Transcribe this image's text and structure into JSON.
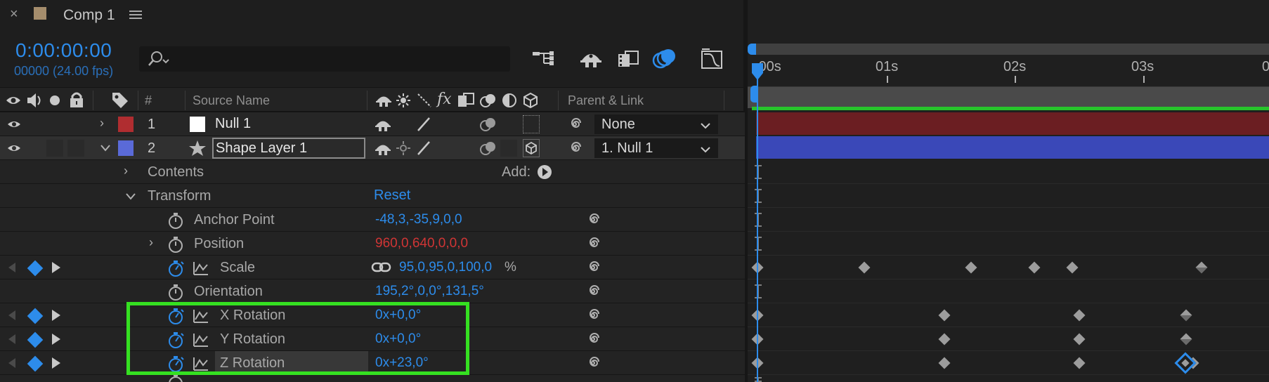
{
  "tab": {
    "close_glyph": "×",
    "title": "Comp 1"
  },
  "header": {
    "timecode": "0:00:00:00",
    "frame_info": "00000 (24.00 fps)",
    "search_placeholder": ""
  },
  "columns": {
    "number": "#",
    "source_name": "Source Name",
    "fx_glyph": "fx",
    "parent_link": "Parent & Link"
  },
  "glyphs": {
    "chevron_right": "›"
  },
  "layers": [
    {
      "number": "1",
      "name": "Null 1",
      "label_color": "#b02d30",
      "parent": "None"
    },
    {
      "number": "2",
      "name": "Shape Layer 1",
      "label_color": "#5a6ad8",
      "parent": "1. Null 1"
    }
  ],
  "props": {
    "contents": "Contents",
    "add_label": "Add:",
    "transform": "Transform",
    "reset": "Reset",
    "anchor_point": {
      "label": "Anchor Point",
      "value": "-48,3,-35,9,0,0"
    },
    "position": {
      "label": "Position",
      "value": "960,0,640,0,0,0"
    },
    "scale": {
      "label": "Scale",
      "value": "95,0,95,0,100,0",
      "unit": "%"
    },
    "orientation": {
      "label": "Orientation",
      "value": "195,2°,0,0°,131,5°"
    },
    "x_rotation": {
      "label": "X Rotation",
      "value": "0x+0,0°"
    },
    "y_rotation": {
      "label": "Y Rotation",
      "value": "0x+0,0°"
    },
    "z_rotation": {
      "label": "Z Rotation",
      "value": "0x+23,0°"
    }
  },
  "ruler": [
    ":00s",
    "01s",
    "02s",
    "03s",
    "0"
  ],
  "colors": {
    "accent": "#2d8ceb",
    "highlight_box": "#35e021",
    "work_area_rendered": "#27c42b",
    "null_layer_bar": "#6b1e22",
    "shape_layer_bar": "#3a48b8"
  }
}
